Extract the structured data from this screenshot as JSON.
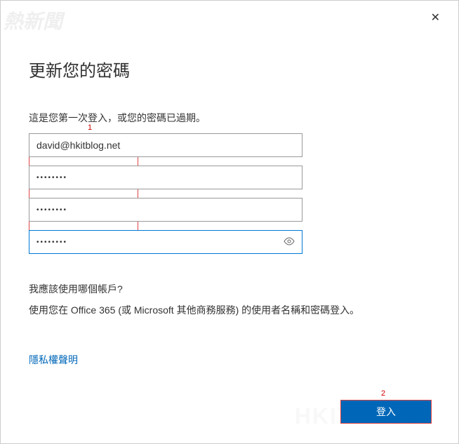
{
  "watermark_top": "熱新聞",
  "watermark_bottom": "HKITBLOG",
  "close_label": "✕",
  "title": "更新您的密碼",
  "subtitle": "這是您第一次登入，或您的密碼已過期。",
  "annotations": {
    "one": "1",
    "two": "2"
  },
  "form": {
    "username": "david@hkitblog.net",
    "old_password_masked": "••••••••",
    "new_password_masked": "••••••••",
    "confirm_password_masked": "••••••••"
  },
  "help": {
    "question": "我應該使用哪個帳戶?",
    "text": "使用您在 Office 365 (或 Microsoft 其他商務服務) 的使用者名稱和密碼登入。"
  },
  "privacy_link": "隱私權聲明",
  "signin_button": "登入"
}
